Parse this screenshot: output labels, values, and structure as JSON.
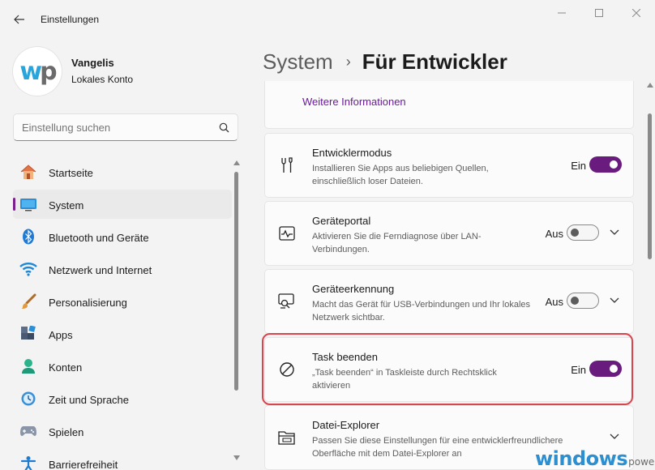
{
  "window": {
    "title": "Einstellungen"
  },
  "profile": {
    "name": "Vangelis",
    "account_type": "Lokales Konto",
    "avatar_letters_1": "w",
    "avatar_letters_2": "p"
  },
  "search": {
    "placeholder": "Einstellung suchen"
  },
  "nav": {
    "items": [
      {
        "label": "Startseite",
        "icon": "home-icon"
      },
      {
        "label": "System",
        "icon": "display-icon",
        "active": true
      },
      {
        "label": "Bluetooth und Geräte",
        "icon": "bluetooth-icon"
      },
      {
        "label": "Netzwerk und Internet",
        "icon": "wifi-icon"
      },
      {
        "label": "Personalisierung",
        "icon": "brush-icon"
      },
      {
        "label": "Apps",
        "icon": "apps-icon"
      },
      {
        "label": "Konten",
        "icon": "person-icon"
      },
      {
        "label": "Zeit und Sprache",
        "icon": "clock-globe-icon"
      },
      {
        "label": "Spielen",
        "icon": "gamepad-icon"
      },
      {
        "label": "Barrierefreiheit",
        "icon": "accessibility-icon"
      }
    ]
  },
  "breadcrumb": {
    "parent": "System",
    "separator": "›",
    "current": "Für Entwickler"
  },
  "main": {
    "more_info_link": "Weitere Informationen",
    "settings": [
      {
        "title": "Entwicklermodus",
        "description": "Installieren Sie Apps aus beliebigen Quellen, einschließlich loser Dateien.",
        "state": "Ein",
        "on": true,
        "expandable": false
      },
      {
        "title": "Geräteportal",
        "description": "Aktivieren Sie die Ferndiagnose über LAN-Verbindungen.",
        "state": "Aus",
        "on": false,
        "expandable": true
      },
      {
        "title": "Geräteerkennung",
        "description": "Macht das Gerät für USB-Verbindungen und Ihr lokales Netzwerk sichtbar.",
        "state": "Aus",
        "on": false,
        "expandable": true
      },
      {
        "title": "Task beenden",
        "description": "„Task beenden“ in Taskleiste durch Rechtsklick aktivieren",
        "state": "Ein",
        "on": true,
        "expandable": false
      },
      {
        "title": "Datei-Explorer",
        "description": "Passen Sie diese Einstellungen für eine entwicklerfreundlichere Oberfläche mit dem Datei-Explorer an",
        "expandable": true
      }
    ]
  },
  "colors": {
    "accent": "#6a1b7e",
    "highlight_border": "#d9454f",
    "link": "#6a1b9a"
  },
  "watermark": {
    "main": "windows",
    "sub": "power"
  }
}
